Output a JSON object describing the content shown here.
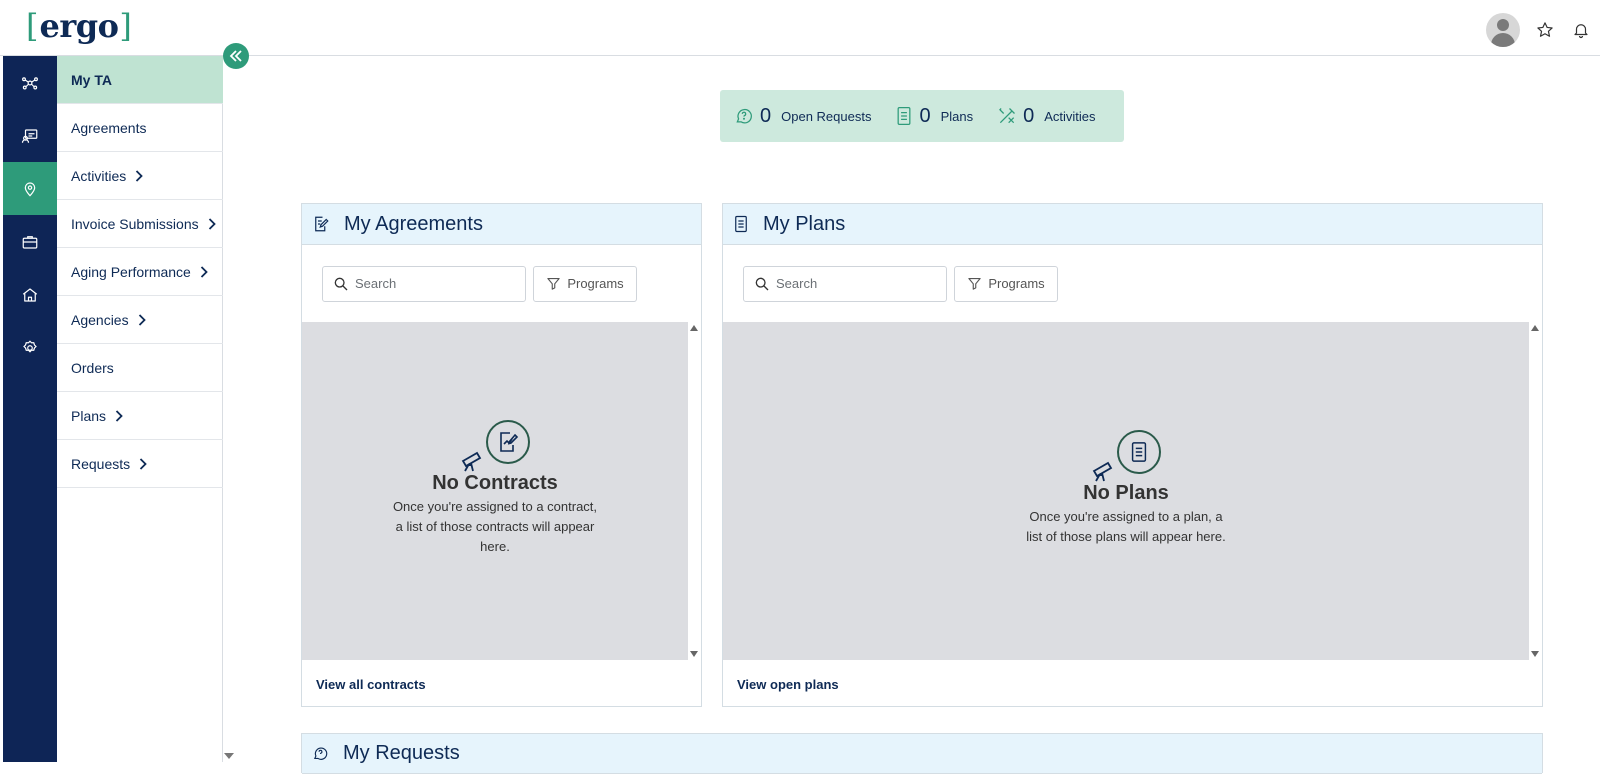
{
  "header": {
    "logo": {
      "bracket_left": "[",
      "word": "ergo",
      "bracket_right": "]"
    }
  },
  "rail": {
    "items": [
      {
        "icon": "network-icon",
        "active": false
      },
      {
        "icon": "projects-icon",
        "active": false
      },
      {
        "icon": "location-pin-icon",
        "active": true
      },
      {
        "icon": "briefcase-icon",
        "active": false
      },
      {
        "icon": "home-icon",
        "active": false
      },
      {
        "icon": "settings-badge-icon",
        "active": false
      }
    ]
  },
  "submenu": {
    "items": [
      {
        "label": "My TA",
        "has_chevron": false,
        "active": true
      },
      {
        "label": "Agreements",
        "has_chevron": false
      },
      {
        "label": "Activities",
        "has_chevron": true
      },
      {
        "label": "Invoice Submissions",
        "has_chevron": true
      },
      {
        "label": "Aging Performance",
        "has_chevron": true
      },
      {
        "label": "Agencies",
        "has_chevron": true
      },
      {
        "label": "Orders",
        "has_chevron": false
      },
      {
        "label": "Plans",
        "has_chevron": true
      },
      {
        "label": "Requests",
        "has_chevron": true
      }
    ]
  },
  "stats": {
    "open_requests": {
      "count": "0",
      "label": "Open Requests"
    },
    "plans": {
      "count": "0",
      "label": "Plans"
    },
    "activities": {
      "count": "0",
      "label": "Activities"
    }
  },
  "agreements": {
    "title": "My Agreements",
    "search_placeholder": "Search",
    "filter_label": "Programs",
    "empty_title": "No Contracts",
    "empty_desc": "Once you're assigned to a contract, a list of those contracts will appear here.",
    "footer_link": "View all contracts"
  },
  "plans_card": {
    "title": "My Plans",
    "search_placeholder": "Search",
    "filter_label": "Programs",
    "empty_title": "No Plans",
    "empty_desc": "Once you're assigned to a plan, a list of those plans will appear here.",
    "footer_link": "View open plans"
  },
  "requests_card": {
    "title": "My Requests"
  },
  "colors": {
    "brand_navy": "#0e2556",
    "brand_green": "#2e9b7a",
    "active_menu": "#bfe3d2",
    "stats_bg": "#cde9dd",
    "card_header_bg": "#e6f4fc"
  }
}
